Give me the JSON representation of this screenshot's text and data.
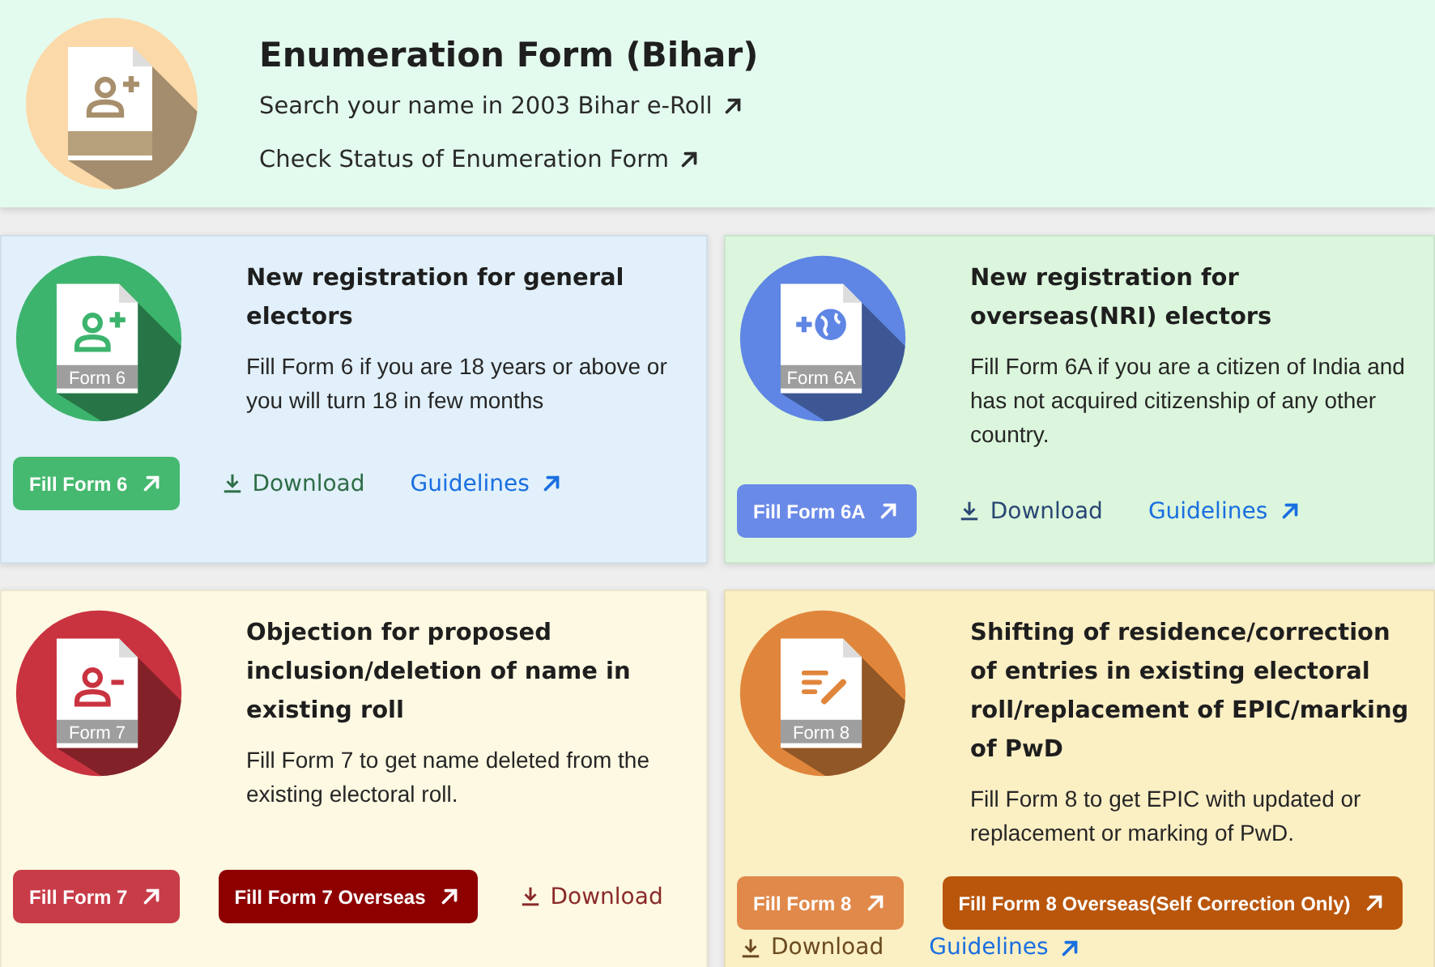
{
  "header": {
    "title": "Enumeration Form (Bihar)",
    "color": "#fcd9a9",
    "links": [
      {
        "label": "Search your name in 2003 Bihar e-Roll"
      },
      {
        "label": "Check Status of Enumeration Form"
      }
    ]
  },
  "cards": [
    {
      "color": "#3db46d",
      "form_label": "Form 6",
      "title": "New registration for general electors",
      "description": "Fill Form 6 if you are 18 years or above or you will turn 18 in few months",
      "actions": [
        {
          "kind": "fill",
          "label": "Fill Form 6",
          "color": "#45b96f"
        },
        {
          "kind": "download",
          "label": "Download",
          "color": "#2e6d47"
        },
        {
          "kind": "guidelines",
          "label": "Guidelines",
          "color": "#1a6fe0"
        }
      ]
    },
    {
      "color": "#5f86e4",
      "form_label": "Form 6A",
      "title": "New registration for overseas(NRI) electors",
      "description": "Fill Form 6A if you are a citizen of India and has not acquired citizenship of any other country.",
      "actions": [
        {
          "kind": "fill",
          "label": "Fill Form 6A",
          "color": "#6a8ae8"
        },
        {
          "kind": "download",
          "label": "Download",
          "color": "#2a4674"
        },
        {
          "kind": "guidelines",
          "label": "Guidelines",
          "color": "#1a6fe0"
        }
      ]
    },
    {
      "color": "#c9333f",
      "form_label": "Form 7",
      "title": "Objection for proposed inclusion/deletion of name in existing roll",
      "description": "Fill Form 7 to get name deleted from the existing electoral roll.",
      "actions": [
        {
          "kind": "fill",
          "label": "Fill Form 7",
          "color": "#c83c48"
        },
        {
          "kind": "fill",
          "label": "Fill Form 7 Overseas",
          "color": "#8e0000"
        },
        {
          "kind": "download",
          "label": "Download",
          "color": "#8a2a2a"
        }
      ]
    },
    {
      "color": "#e0863c",
      "form_label": "Form 8",
      "title": "Shifting of residence/correction of entries in existing electoral roll/replacement of EPIC/marking of PwD",
      "description": "Fill Form 8 to get EPIC with updated or replacement or marking of PwD.",
      "actions": [
        {
          "kind": "fill",
          "label": "Fill Form 8",
          "color": "#e0894a"
        },
        {
          "kind": "fill",
          "label": "Fill Form 8 Overseas(Self Correction Only)",
          "color": "#b9560c"
        },
        {
          "kind": "download",
          "label": "Download",
          "color": "#6b4a20"
        },
        {
          "kind": "guidelines",
          "label": "Guidelines",
          "color": "#1a6fe0"
        }
      ]
    }
  ]
}
